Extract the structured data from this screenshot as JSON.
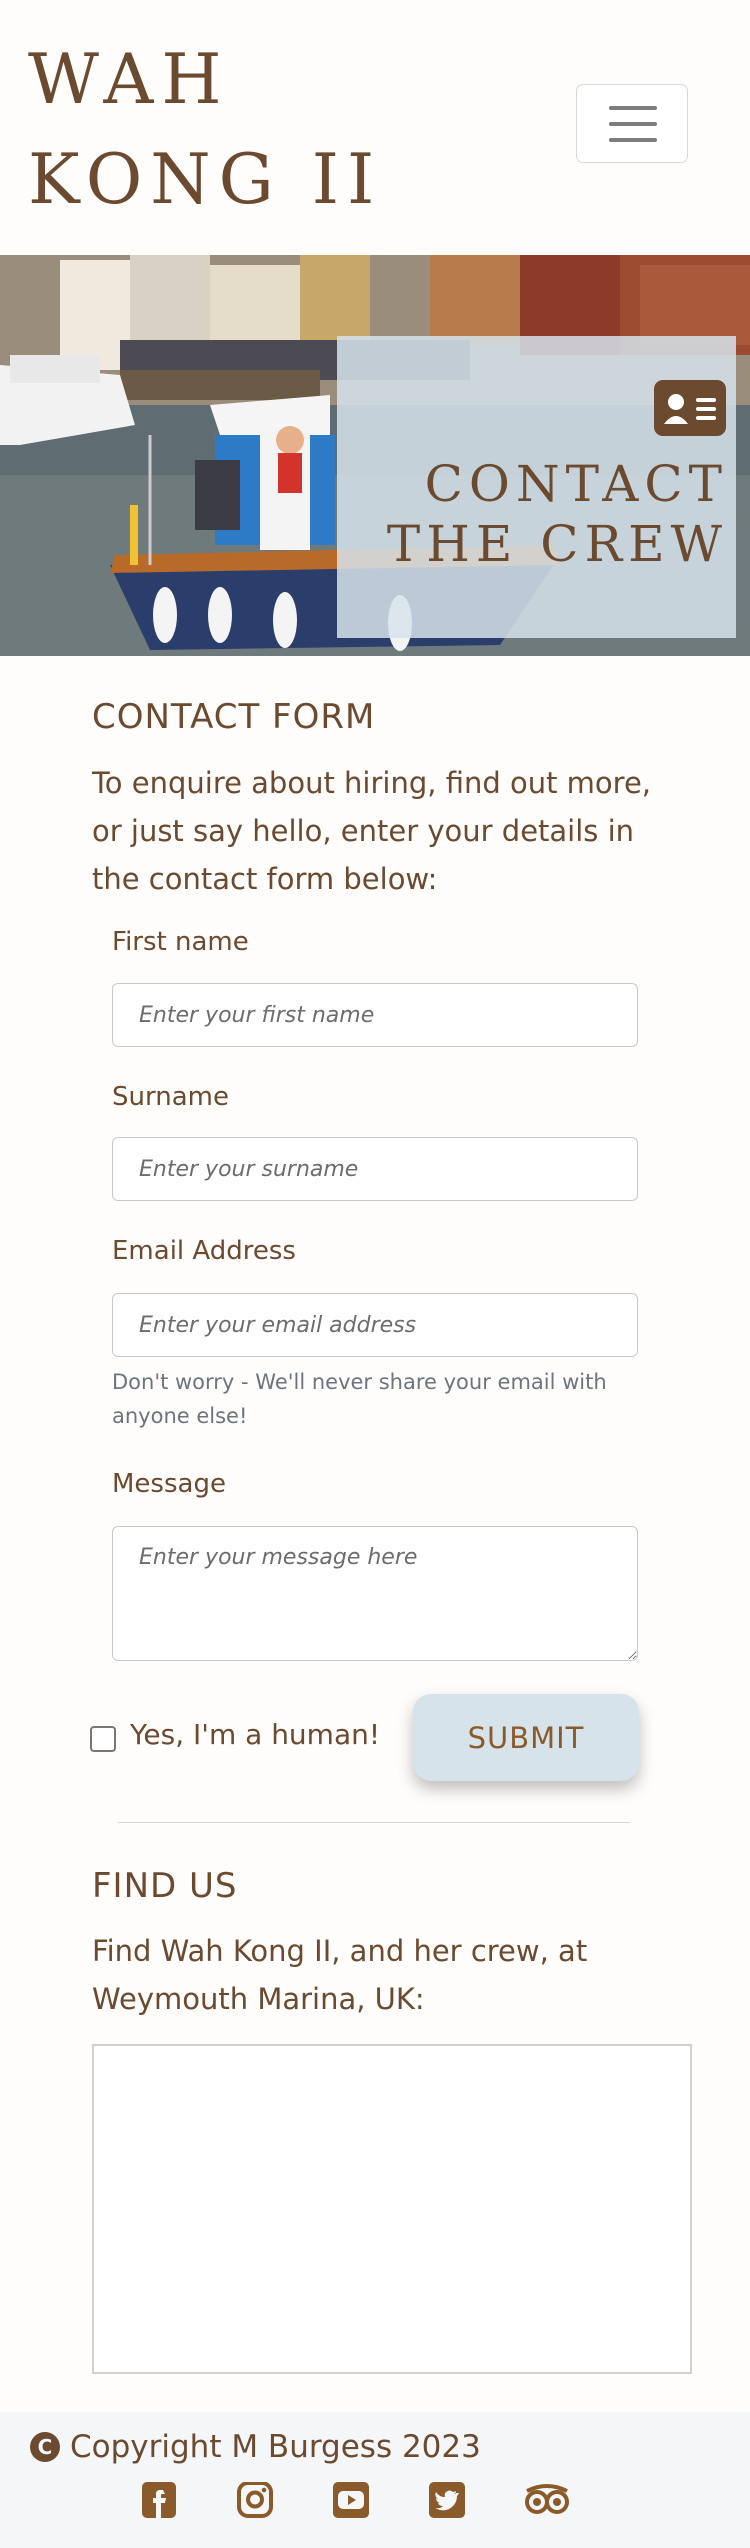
{
  "header": {
    "brand": "WAH KONG II",
    "menu_icon": "hamburger-menu-icon"
  },
  "hero": {
    "icon": "address-card-icon",
    "title_line1": "CONTACT",
    "title_line2": "THE CREW"
  },
  "contact": {
    "heading": "CONTACT FORM",
    "intro": "To enquire about hiring, find out more, or just say hello, enter your details in the contact form below:",
    "first_name": {
      "label": "First name",
      "placeholder": "Enter your first name",
      "value": ""
    },
    "surname": {
      "label": "Surname",
      "placeholder": "Enter your surname",
      "value": ""
    },
    "email": {
      "label": "Email Address",
      "placeholder": "Enter your email address",
      "value": "",
      "help": "Don't worry - We'll never share your email with anyone else!"
    },
    "message": {
      "label": "Message",
      "placeholder": "Enter your message here",
      "value": ""
    },
    "human_check": {
      "label": "Yes, I'm a human!",
      "checked": false
    },
    "submit": "SUBMIT"
  },
  "find_us": {
    "heading": "FIND US",
    "text": "Find Wah Kong II, and her crew, at Weymouth Marina, UK:"
  },
  "footer": {
    "copyright_icon": "copyright-icon",
    "copyright": "Copyright M Burgess 2023",
    "social": [
      "facebook-icon",
      "instagram-icon",
      "youtube-icon",
      "twitter-icon",
      "tripadvisor-icon"
    ]
  },
  "colors": {
    "brand_brown": "#6b4a2f",
    "panel_blue": "#d6e3eb",
    "footer_bg": "#f5f6f8"
  }
}
